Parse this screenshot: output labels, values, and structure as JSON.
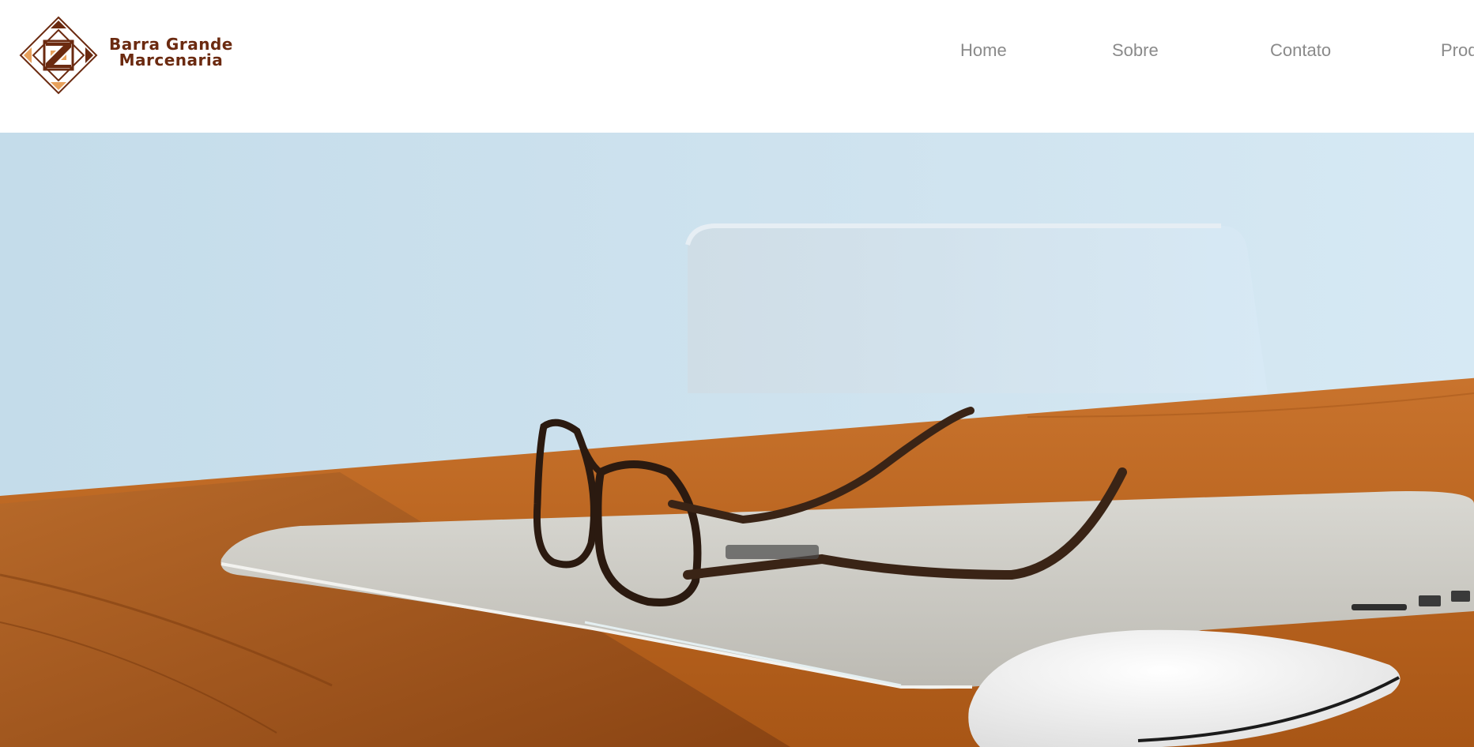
{
  "brand": {
    "line1": "Barra Grande",
    "line2": "Marcenaria",
    "color": "#6b2a10",
    "accent": "#e8a15c"
  },
  "nav": {
    "items": [
      {
        "label": "Home"
      },
      {
        "label": "Sobre"
      },
      {
        "label": "Contato"
      },
      {
        "label": "Produtos"
      }
    ],
    "color": "#8a8a8a"
  },
  "hero": {
    "image": "laptop-glasses-mouse-on-wooden-desk"
  }
}
